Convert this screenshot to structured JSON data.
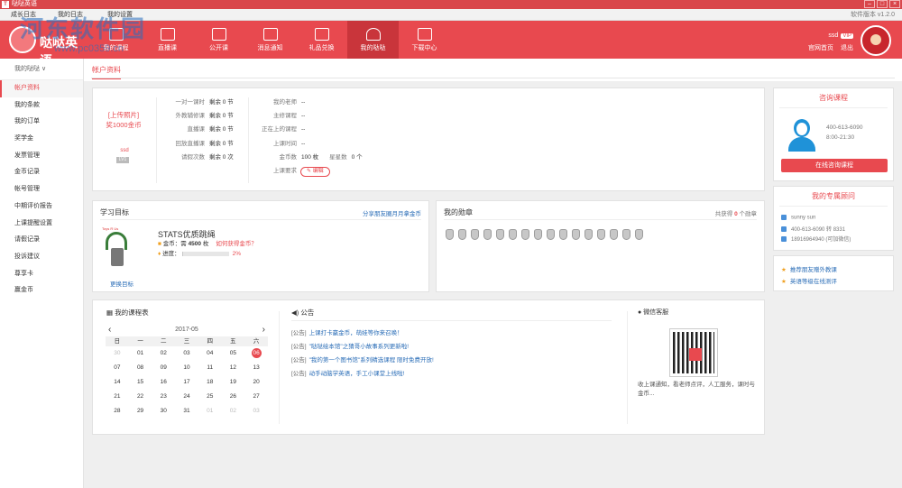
{
  "titlebar": {
    "title": "哒哒英语",
    "min": "–",
    "max": "□",
    "close": "×"
  },
  "menubar": {
    "items": [
      "成长日志",
      "我的日志",
      "我的设置"
    ],
    "version": "软件版本 v1.2.0"
  },
  "logo": {
    "text": "哒哒英语"
  },
  "nav": [
    {
      "label": "我的课程"
    },
    {
      "label": "直播课"
    },
    {
      "label": "公开课"
    },
    {
      "label": "消息通知"
    },
    {
      "label": "礼品兑换"
    },
    {
      "label": "我的哒哒"
    },
    {
      "label": "下载中心"
    }
  ],
  "user": {
    "name": "ssd",
    "vip": "VIP",
    "home": "官网首页",
    "logout": "退出"
  },
  "sidebar": {
    "header": "我的哒哒 ∨",
    "items": [
      "帐户资料",
      "我的条款",
      "我的订单",
      "奖学金",
      "发票管理",
      "金币记录",
      "帐号管理",
      "中期评价报告",
      "上课提醒设置",
      "请假记录",
      "投诉建议",
      "尊享卡",
      "赢金币"
    ]
  },
  "tab": "帐户资料",
  "account": {
    "upload_line1": "[上传照片]",
    "upload_line2": "奖1000金币",
    "username": "ssd",
    "level": "LV1",
    "lessons": [
      {
        "label": "一对一课时",
        "value": "剩余 0 节"
      },
      {
        "label": "外教辅修课",
        "value": "剩余 0 节"
      },
      {
        "label": "直播课",
        "value": "剩余 0 节"
      },
      {
        "label": "回放直播课",
        "value": "剩余 0 节"
      },
      {
        "label": "请假次数",
        "value": "剩余 0 次"
      }
    ],
    "info": [
      {
        "label": "我的老师",
        "value": "--"
      },
      {
        "label": "主修课程",
        "value": "--"
      },
      {
        "label": "正在上的课程",
        "value": "--"
      },
      {
        "label": "上课时间",
        "value": "--"
      }
    ],
    "coins_label": "金币数",
    "coins_value": "100 枚",
    "points_label": "星星数",
    "points_value": "0 个",
    "req_label": "上课要求",
    "edit": "编辑"
  },
  "goal": {
    "title": "学习目标",
    "share": "分享朋友圈月月拿金币",
    "toy_brand": "Toys R Us",
    "product": "STATS优质跳绳",
    "coin_text": "金币：需",
    "coin_num": "4500",
    "coin_unit": "枚",
    "how": "如何获得金币？",
    "progress_label": "进度：",
    "progress_pct": "2%",
    "progress_value": 0.02,
    "change": "更换目标"
  },
  "medals": {
    "title": "我的勋章",
    "count_pre": "共获得",
    "count": "0",
    "count_post": "个勋章",
    "num": 16
  },
  "schedule": {
    "title": "我的课程表",
    "month": "2017-05",
    "weekdays": [
      "日",
      "一",
      "二",
      "三",
      "四",
      "五",
      "六"
    ],
    "days": [
      {
        "d": "30",
        "dim": true
      },
      {
        "d": "01"
      },
      {
        "d": "02"
      },
      {
        "d": "03"
      },
      {
        "d": "04"
      },
      {
        "d": "05"
      },
      {
        "d": "06",
        "today": true
      },
      {
        "d": "07"
      },
      {
        "d": "08"
      },
      {
        "d": "09"
      },
      {
        "d": "10"
      },
      {
        "d": "11"
      },
      {
        "d": "12"
      },
      {
        "d": "13"
      },
      {
        "d": "14"
      },
      {
        "d": "15"
      },
      {
        "d": "16"
      },
      {
        "d": "17"
      },
      {
        "d": "18"
      },
      {
        "d": "19"
      },
      {
        "d": "20"
      },
      {
        "d": "21"
      },
      {
        "d": "22"
      },
      {
        "d": "23"
      },
      {
        "d": "24"
      },
      {
        "d": "25"
      },
      {
        "d": "26"
      },
      {
        "d": "27"
      },
      {
        "d": "28"
      },
      {
        "d": "29"
      },
      {
        "d": "30"
      },
      {
        "d": "31"
      },
      {
        "d": "01",
        "dim": true
      },
      {
        "d": "02",
        "dim": true
      },
      {
        "d": "03",
        "dim": true
      }
    ]
  },
  "notice": {
    "title": "公告",
    "items": [
      {
        "tag": "[公告]",
        "text": "上课打卡赢金币，萌娃等你来召唤！"
      },
      {
        "tag": "[公告]",
        "text": "\"哒哒绘本馆\"之猜哥小故事系列更新啦!"
      },
      {
        "tag": "[公告]",
        "text": "\"我的第一个图书馆\"系列精选课程 限时免费开放!"
      },
      {
        "tag": "[公告]",
        "text": "动手动脑学英语，手工小课堂上线啦!"
      }
    ]
  },
  "wechat": {
    "title": "微信客服",
    "desc": "收上课通知，看老师点评，人工服务，课时与金币..."
  },
  "consult": {
    "title": "咨询课程",
    "phone": "400-613-6090",
    "hours": "8:00-21:30",
    "button": "在线咨询课程"
  },
  "advisor": {
    "title": "我的专属顾问",
    "name": "sunny sun",
    "phone": "400-613-6090 转 8331",
    "mobile": "18916964940 (可加微信)"
  },
  "links": [
    "推荐朋友赠外教课",
    "英语等级在线测评"
  ],
  "watermark": {
    "text": "河东软件园",
    "url": "www.pc0359.cn"
  },
  "colors": {
    "brand": "#e8494f",
    "link": "#2a6db7"
  }
}
